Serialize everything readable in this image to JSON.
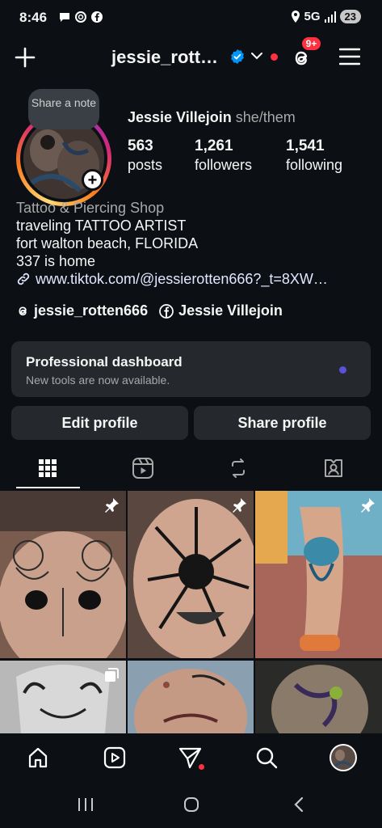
{
  "status_bar": {
    "time": "8:46",
    "network": "5G",
    "battery": "23"
  },
  "header": {
    "username": "jessie_rott…",
    "threads_badge": "9+"
  },
  "profile": {
    "note_label": "Share a note",
    "full_name": "Jessie Villejoin",
    "pronouns": "she/them",
    "stats": [
      {
        "value": "563",
        "label": "posts"
      },
      {
        "value": "1,261",
        "label": "followers"
      },
      {
        "value": "1,541",
        "label": "following"
      }
    ]
  },
  "bio": {
    "category": "Tattoo & Piercing Shop",
    "lines": [
      "traveling TATTOO ARTIST",
      "fort walton beach, FLORIDA",
      "337 is home"
    ],
    "link": "www.tiktok.com/@jessierotten666?_t=8XW…",
    "threads_handle": "jessie_rotten666",
    "facebook_name": "Jessie Villejoin"
  },
  "dashboard": {
    "title": "Professional dashboard",
    "subtitle": "New tools are now available."
  },
  "buttons": {
    "edit": "Edit profile",
    "share": "Share profile"
  },
  "tabs": [
    "grid-icon",
    "reels-icon",
    "reposts-icon",
    "tagged-icon"
  ],
  "colors": {
    "background": "#0c1014",
    "surface": "#25292e",
    "accent_blue": "#0095f6",
    "notification_red": "#ff3040",
    "dashboard_dot": "#5b51d8"
  }
}
